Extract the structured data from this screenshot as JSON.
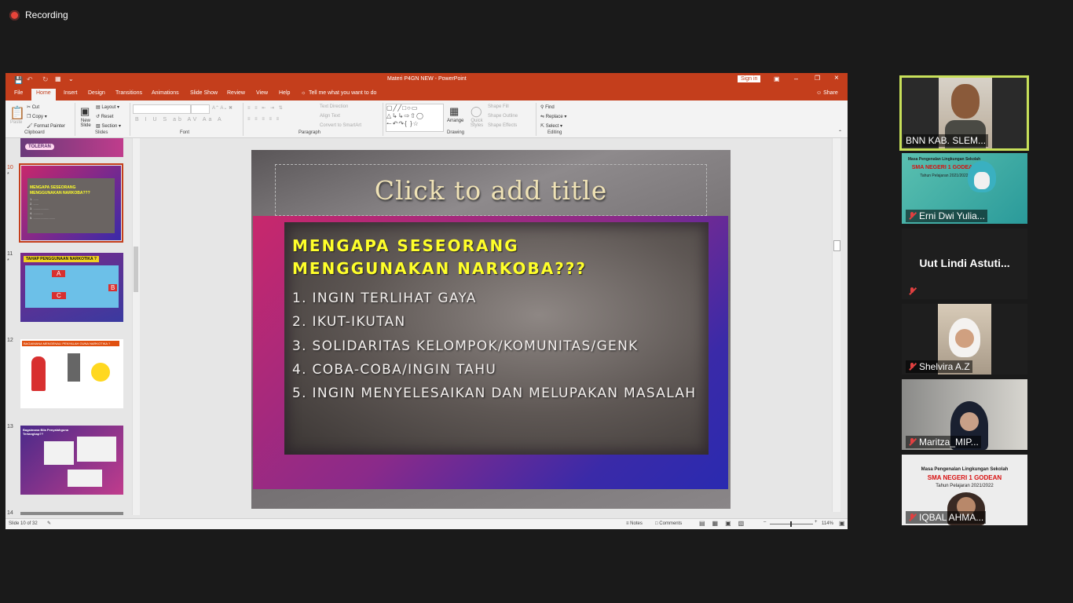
{
  "recording": {
    "label": "Recording"
  },
  "window": {
    "title": "Materi P4GN NEW  -  PowerPoint",
    "sign_in": "Sign in",
    "tabs": [
      "File",
      "Home",
      "Insert",
      "Design",
      "Transitions",
      "Animations",
      "Slide Show",
      "Review",
      "View",
      "Help"
    ],
    "tell_me": "Tell me what you want to do",
    "share": "Share"
  },
  "ribbon": {
    "clipboard": {
      "paste": "Paste",
      "cut": "Cut",
      "copy": "Copy",
      "format_painter": "Format Painter",
      "group": "Clipboard"
    },
    "slides": {
      "new_slide": "New Slide",
      "layout": "Layout",
      "reset": "Reset",
      "section": "Section",
      "group": "Slides"
    },
    "font": {
      "group": "Font"
    },
    "paragraph": {
      "text_direction": "Text Direction",
      "align_text": "Align Text",
      "convert": "Convert to SmartArt",
      "group": "Paragraph"
    },
    "drawing": {
      "arrange": "Arrange",
      "quick_styles": "Quick Styles",
      "shape_fill": "Shape Fill",
      "shape_outline": "Shape Outline",
      "shape_effects": "Shape Effects",
      "group": "Drawing"
    },
    "editing": {
      "find": "Find",
      "replace": "Replace",
      "select": "Select",
      "group": "Editing"
    }
  },
  "thumbnails": [
    {
      "num": "10",
      "star": "*",
      "title": "MENGAPA SESEORANG MENGGUNAKAN NARKOBA???"
    },
    {
      "num": "11",
      "star": "*",
      "title": "TAHAP PENGGUNAAN NARKOTIKA ?",
      "labels": [
        "A",
        "B",
        "C"
      ]
    },
    {
      "num": "12",
      "title": "BAGAIMANA MENGENALI PENYALAH GUNA NARKOTIKA ?"
    },
    {
      "num": "13",
      "title": "Bagaimana Bila Penyalahguna Tertangkap??"
    },
    {
      "num": "14"
    }
  ],
  "top_thumb_label": "TOLERAN",
  "slide": {
    "title_placeholder": "Click to add title",
    "heading_line1": "MENGAPA SESEORANG",
    "heading_line2": "MENGGUNAKAN NARKOBA???",
    "items": [
      "1. INGIN TERLIHAT GAYA",
      "2. IKUT-IKUTAN",
      "3. SOLIDARITAS KELOMPOK/KOMUNITAS/GENK",
      "4. COBA-COBA/INGIN TAHU",
      "5. INGIN MENYELESAIKAN DAN MELUPAKAN MASALAH"
    ]
  },
  "status": {
    "slide_info": "Slide 10 of 32",
    "notes": "Notes",
    "comments": "Comments",
    "zoom": "114%"
  },
  "participants": [
    {
      "name": "BNN KAB. SLEM...",
      "active": true,
      "muted": false
    },
    {
      "name": "Erni Dwi Yulia...",
      "muted": true,
      "banner_line1": "Masa Pengenalan Lingkungan Sekolah",
      "banner_line2": "SMA NEGERI 1 GODEAN",
      "banner_line3": "Tahun Pelajaran 2021/2022"
    },
    {
      "name": "Uut Lindi Astuti...",
      "muted": true
    },
    {
      "name": "Shelvira A.Z",
      "muted": true
    },
    {
      "name": "Maritza_MIP...",
      "muted": true
    },
    {
      "name": "IQBAL AHMA...",
      "muted": true,
      "banner_line1": "Masa Pengenalan Lingkungan Sekolah",
      "banner_line2": "SMA NEGERI 1 GODEAN",
      "banner_line3": "Tahun Pelajaran 2021/2022"
    }
  ],
  "colors": {
    "ppt_accent": "#c43e1c",
    "slide_heading": "#ffff2a",
    "active_speaker": "#c8e05a",
    "mute": "#e04040"
  }
}
